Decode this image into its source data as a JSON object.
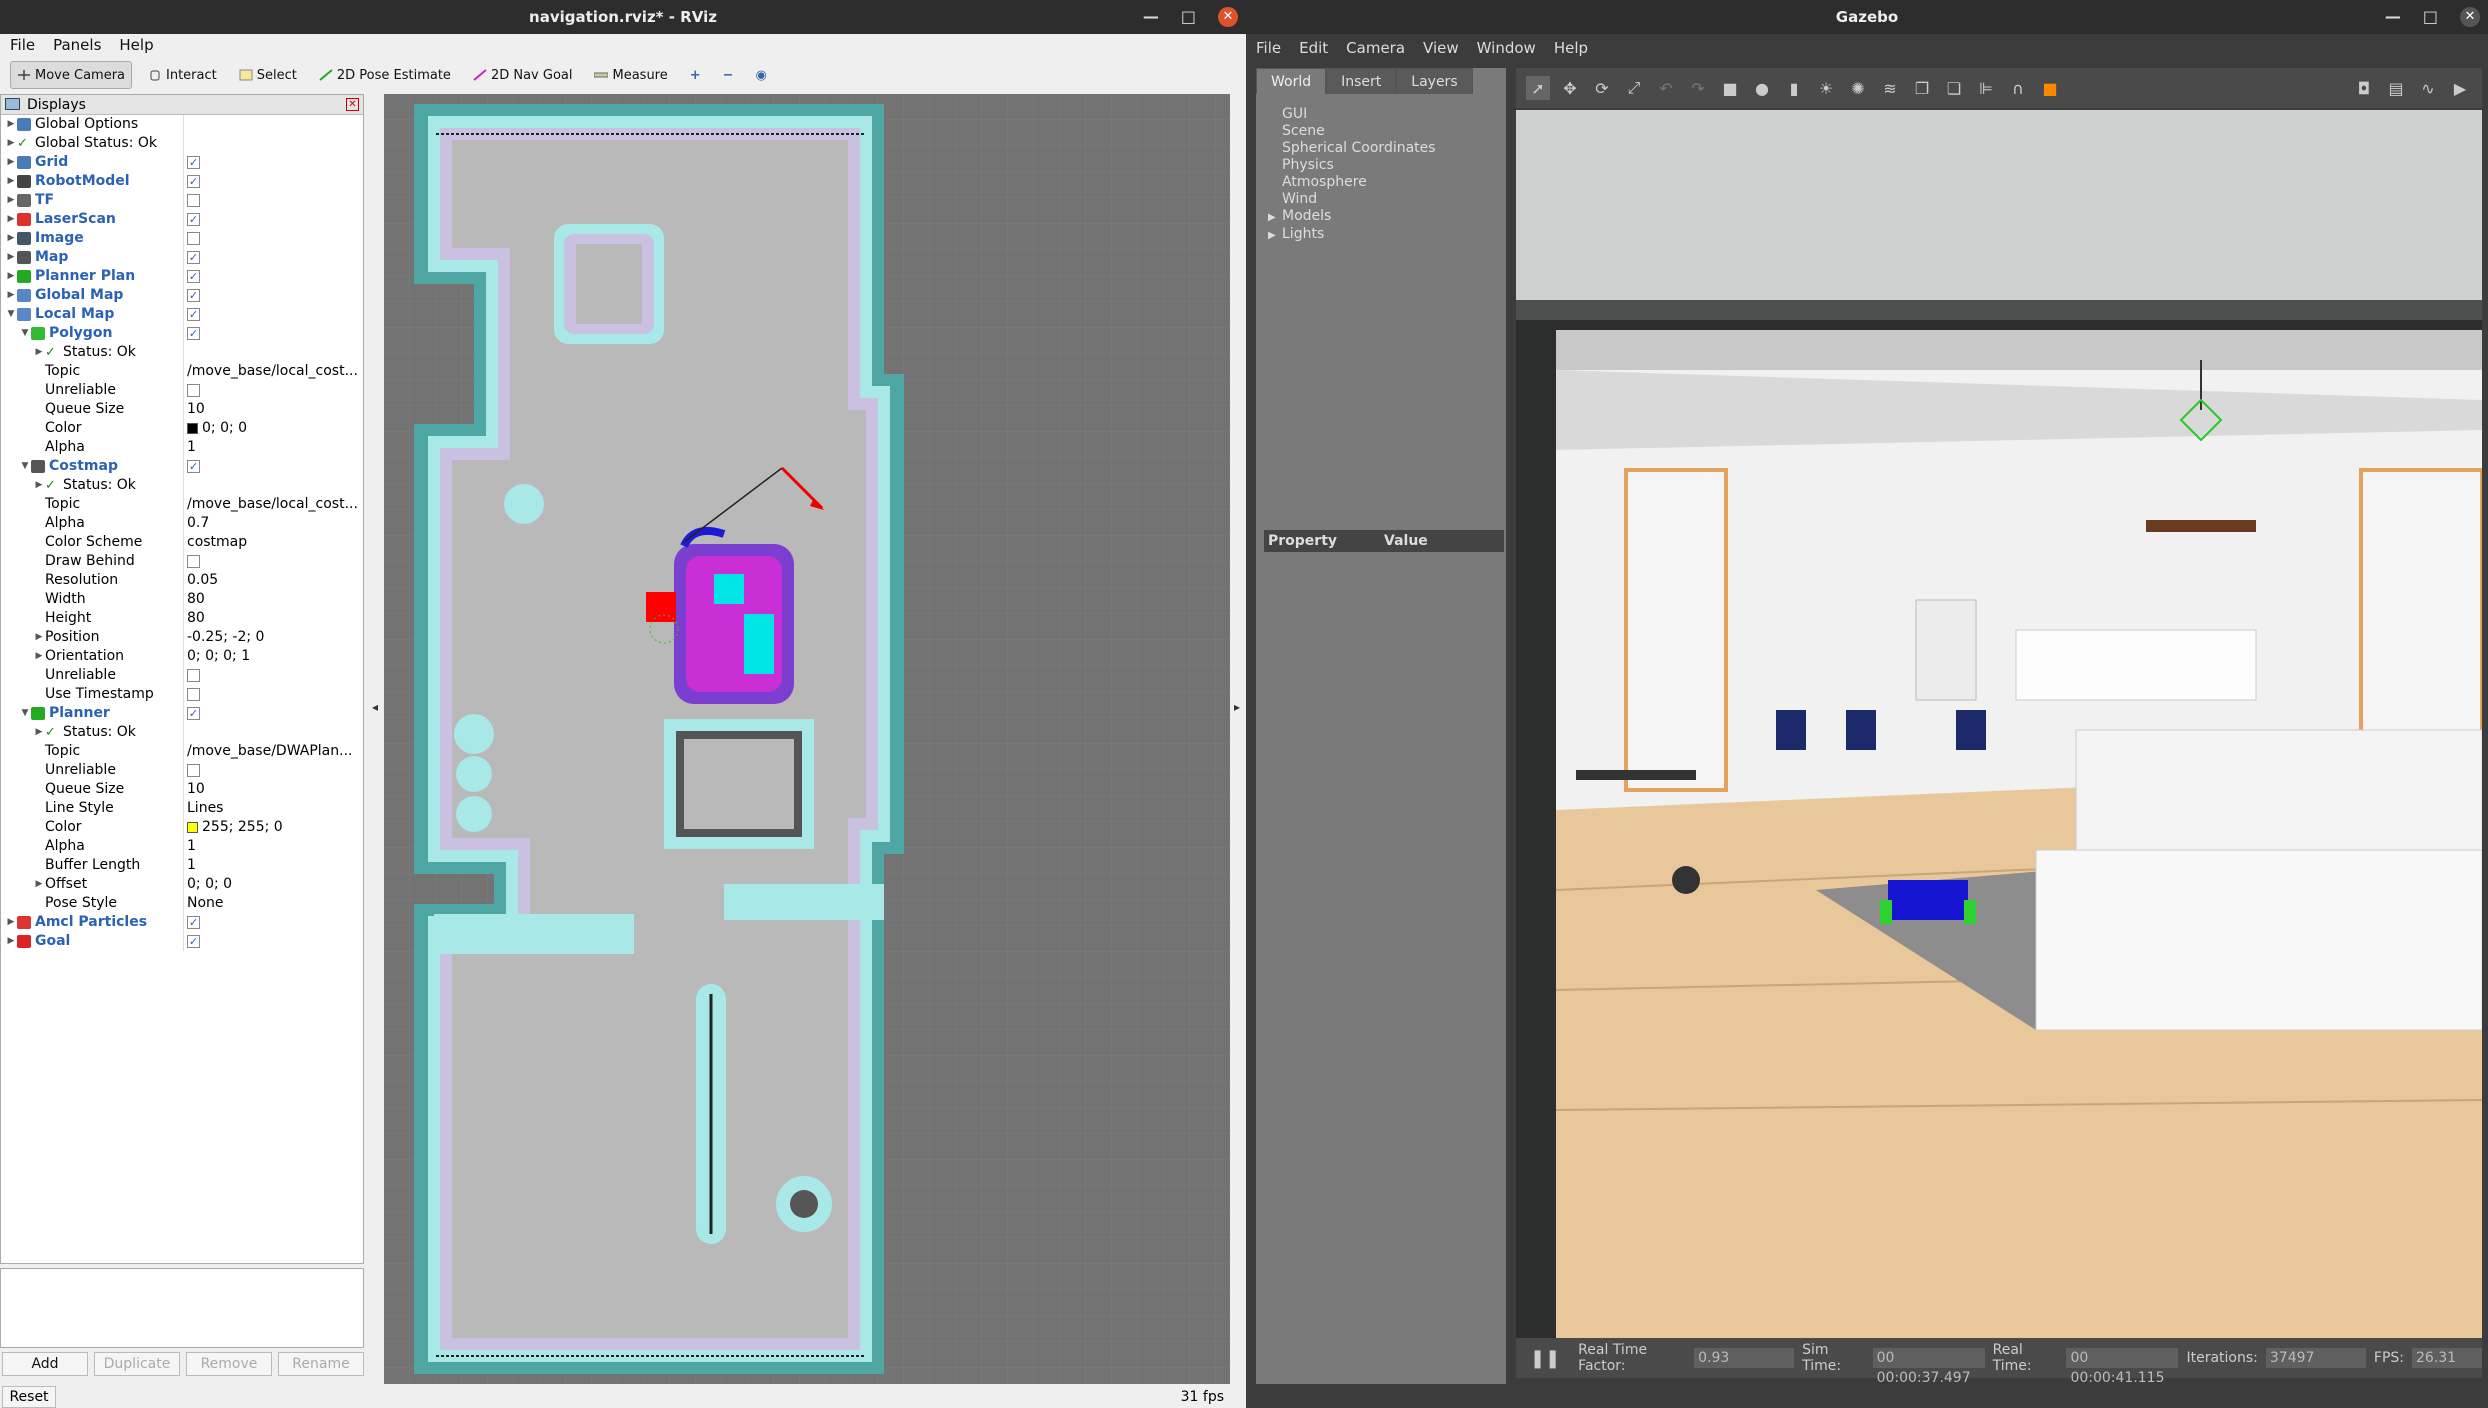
{
  "rviz": {
    "title": "navigation.rviz* - RViz",
    "menu": [
      "File",
      "Panels",
      "Help"
    ],
    "toolbar": {
      "move_camera": "Move Camera",
      "interact": "Interact",
      "select": "Select",
      "pose_estimate": "2D Pose Estimate",
      "nav_goal": "2D Nav Goal",
      "measure": "Measure"
    },
    "panel_title": "Displays",
    "tree": [
      {
        "label": "Global Options",
        "value": ""
      },
      {
        "label": "Global Status: Ok",
        "value": ""
      },
      {
        "label": "Grid",
        "value": "✓"
      },
      {
        "label": "RobotModel",
        "value": "✓"
      },
      {
        "label": "TF",
        "value": ""
      },
      {
        "label": "LaserScan",
        "value": "✓"
      },
      {
        "label": "Image",
        "value": ""
      },
      {
        "label": "Map",
        "value": "✓"
      },
      {
        "label": "Planner Plan",
        "value": "✓"
      },
      {
        "label": "Global Map",
        "value": "✓"
      },
      {
        "label": "Local Map",
        "value": "✓"
      },
      {
        "label": "Polygon",
        "value": "✓"
      },
      {
        "label": "Status: Ok",
        "value": ""
      },
      {
        "label": "Topic",
        "value": "/move_base/local_cost..."
      },
      {
        "label": "Unreliable",
        "value": ""
      },
      {
        "label": "Queue Size",
        "value": "10"
      },
      {
        "label": "Color",
        "value": "0; 0; 0"
      },
      {
        "label": "Alpha",
        "value": "1"
      },
      {
        "label": "Costmap",
        "value": "✓"
      },
      {
        "label": "Status: Ok",
        "value": ""
      },
      {
        "label": "Topic",
        "value": "/move_base/local_cost..."
      },
      {
        "label": "Alpha",
        "value": "0.7"
      },
      {
        "label": "Color Scheme",
        "value": "costmap"
      },
      {
        "label": "Draw Behind",
        "value": ""
      },
      {
        "label": "Resolution",
        "value": "0.05"
      },
      {
        "label": "Width",
        "value": "80"
      },
      {
        "label": "Height",
        "value": "80"
      },
      {
        "label": "Position",
        "value": "-0.25; -2; 0"
      },
      {
        "label": "Orientation",
        "value": "0; 0; 0; 1"
      },
      {
        "label": "Unreliable",
        "value": ""
      },
      {
        "label": "Use Timestamp",
        "value": ""
      },
      {
        "label": "Planner",
        "value": "✓"
      },
      {
        "label": "Status: Ok",
        "value": ""
      },
      {
        "label": "Topic",
        "value": "/move_base/DWAPlan..."
      },
      {
        "label": "Unreliable",
        "value": ""
      },
      {
        "label": "Queue Size",
        "value": "10"
      },
      {
        "label": "Line Style",
        "value": "Lines"
      },
      {
        "label": "Color",
        "value": "255; 255; 0"
      },
      {
        "label": "Alpha",
        "value": "1"
      },
      {
        "label": "Buffer Length",
        "value": "1"
      },
      {
        "label": "Offset",
        "value": "0; 0; 0"
      },
      {
        "label": "Pose Style",
        "value": "None"
      },
      {
        "label": "Amcl Particles",
        "value": "✓"
      },
      {
        "label": "Goal",
        "value": "✓"
      }
    ],
    "buttons": {
      "add": "Add",
      "duplicate": "Duplicate",
      "remove": "Remove",
      "rename": "Rename",
      "reset": "Reset"
    },
    "fps": "31 fps"
  },
  "gazebo": {
    "title": "Gazebo",
    "menu": [
      "File",
      "Edit",
      "Camera",
      "View",
      "Window",
      "Help"
    ],
    "tabs": [
      "World",
      "Insert",
      "Layers"
    ],
    "world_items": [
      "GUI",
      "Scene",
      "Spherical Coordinates",
      "Physics",
      "Atmosphere",
      "Wind",
      "Models",
      "Lights"
    ],
    "property_header": "Property",
    "value_header": "Value",
    "status": {
      "rtf_label": "Real Time Factor:",
      "rtf": "0.93",
      "sim_label": "Sim Time:",
      "sim": "00 00:00:37.497",
      "real_label": "Real Time:",
      "real": "00 00:00:41.115",
      "iter_label": "Iterations:",
      "iter": "37497",
      "fps_label": "FPS:",
      "fps": "26.31"
    }
  }
}
